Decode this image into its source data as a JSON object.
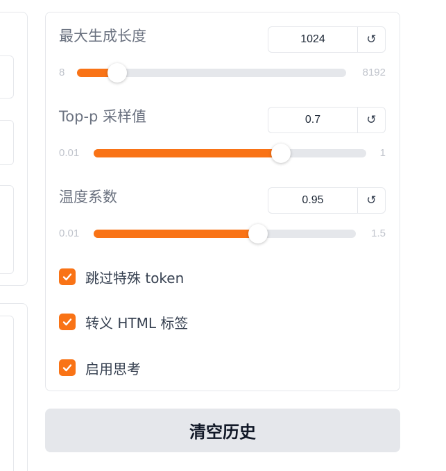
{
  "sliders": [
    {
      "label": "最大生成长度",
      "value": "1024",
      "min": "8",
      "max": "8192",
      "fill_fraction": 0.15
    },
    {
      "label": "Top-p 采样值",
      "value": "0.7",
      "min": "0.01",
      "max": "1",
      "fill_fraction": 0.686
    },
    {
      "label": "温度系数",
      "value": "0.95",
      "min": "0.01",
      "max": "1.5",
      "fill_fraction": 0.626
    }
  ],
  "reset_icon": "↺",
  "checkboxes": [
    {
      "label": "跳过特殊 token",
      "checked": true
    },
    {
      "label": "转义 HTML 标签",
      "checked": true
    },
    {
      "label": "启用思考",
      "checked": true
    }
  ],
  "clear_button": "清空历史",
  "colors": {
    "accent": "#f97316",
    "track": "#e5e7eb",
    "button_bg": "#e5e7eb"
  }
}
